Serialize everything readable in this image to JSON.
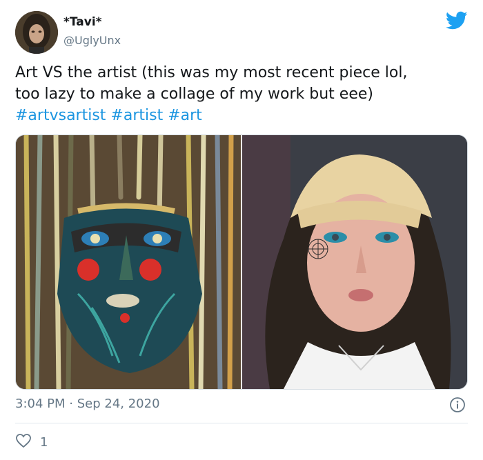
{
  "user": {
    "display_name": "*Tavi*",
    "handle": "@UglyUnx",
    "avatar_icon": "profile-avatar"
  },
  "tweet": {
    "text_line1": "Art VS the artist (this was my most recent piece lol,",
    "text_line2": "too lazy to make a collage of my work but eee)",
    "hashtags": [
      "#artvsartist",
      "#artist",
      "#art"
    ]
  },
  "media": {
    "left_description": "painting",
    "right_description": "photo"
  },
  "meta": {
    "time": "3:04 PM",
    "separator": "·",
    "date": "Sep 24, 2020"
  },
  "engagement": {
    "likes": "1"
  },
  "colors": {
    "brand": "#1da1f2",
    "link": "#1b95e0",
    "muted": "#657786"
  },
  "icons": {
    "logo": "twitter-bird-icon",
    "info": "info-icon",
    "like": "heart-icon"
  }
}
